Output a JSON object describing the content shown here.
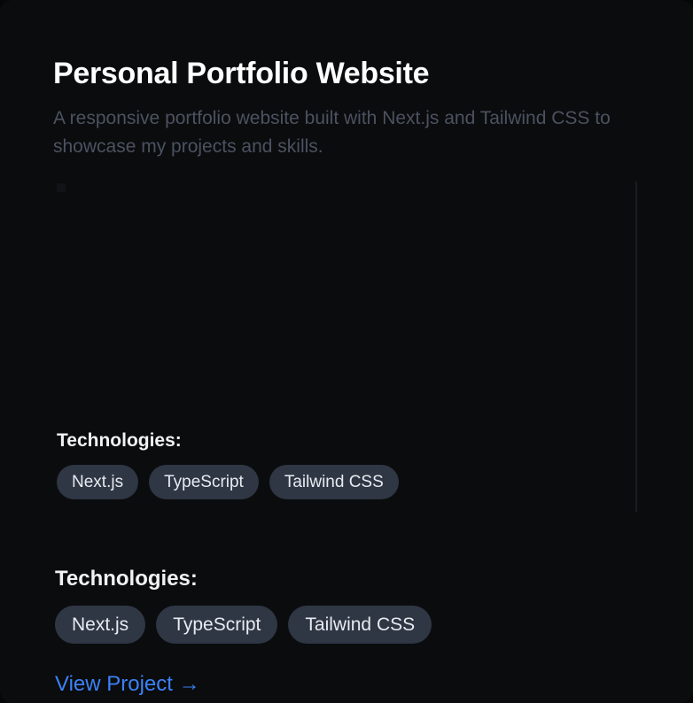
{
  "project": {
    "title": "Personal Portfolio Website",
    "description": "A responsive portfolio website built with Next.js and Tailwind CSS to showcase my projects and skills."
  },
  "preview": {
    "technologies_label": "Technologies:",
    "technologies": [
      "Next.js",
      "TypeScript",
      "Tailwind CSS"
    ]
  },
  "details": {
    "technologies_label": "Technologies:",
    "technologies": [
      "Next.js",
      "TypeScript",
      "Tailwind CSS"
    ],
    "view_link": "View Project →"
  },
  "colors": {
    "background": "#0b0c0e",
    "muted_text": "#4b5260",
    "chip_background": "#2f3644",
    "link": "#3b82f6"
  }
}
